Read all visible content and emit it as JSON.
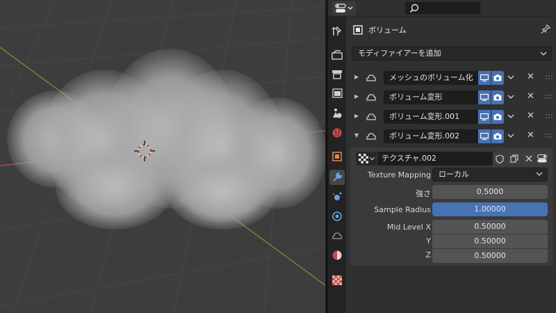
{
  "colors": {
    "accent": "#4772b3",
    "viewport_bg": "#3d3d3d",
    "panel_bg": "#303030",
    "axis_x": "#b05555",
    "axis_y": "#6f9a3c"
  },
  "header": {
    "editor_type_icon": "properties-editor-icon",
    "search_icon": "search-icon",
    "search_placeholder": ""
  },
  "tabs": [
    {
      "icon": "tool-icon"
    },
    {
      "icon": "render-icon"
    },
    {
      "icon": "output-icon"
    },
    {
      "icon": "view-layer-icon"
    },
    {
      "icon": "scene-icon"
    },
    {
      "icon": "world-icon"
    },
    {
      "icon": "object-icon"
    },
    {
      "icon": "modifier-wrench-icon",
      "active": true
    },
    {
      "icon": "particles-icon"
    },
    {
      "icon": "physics-icon"
    },
    {
      "icon": "volume-data-icon"
    },
    {
      "icon": "material-icon"
    },
    {
      "icon": "texture-icon"
    }
  ],
  "object": {
    "name": "ボリューム",
    "icon": "volume-object-icon",
    "pin_icon": "pin-icon"
  },
  "add_modifier": {
    "label": "モディファイアーを追加"
  },
  "modifiers": [
    {
      "name": "メッシュのボリューム化",
      "expanded": false
    },
    {
      "name": "ボリューム変形",
      "expanded": false
    },
    {
      "name": "ボリューム変形.001",
      "expanded": false
    },
    {
      "name": "ボリューム変形.002",
      "expanded": true
    }
  ],
  "active_modifier": {
    "texture_name": "テクスチャ.002",
    "texture_mapping_label": "Texture Mapping",
    "texture_mapping_value": "ローカル",
    "strength_label": "強さ",
    "strength_value": "0.5000",
    "sample_radius_label": "Sample Radius",
    "sample_radius_value": "1.00000",
    "mid_level_x_label": "Mid Level X",
    "mid_level_x_value": "0.50000",
    "mid_level_y_label": "Y",
    "mid_level_y_value": "0.50000",
    "mid_level_z_label": "Z",
    "mid_level_z_value": "0.50000"
  }
}
